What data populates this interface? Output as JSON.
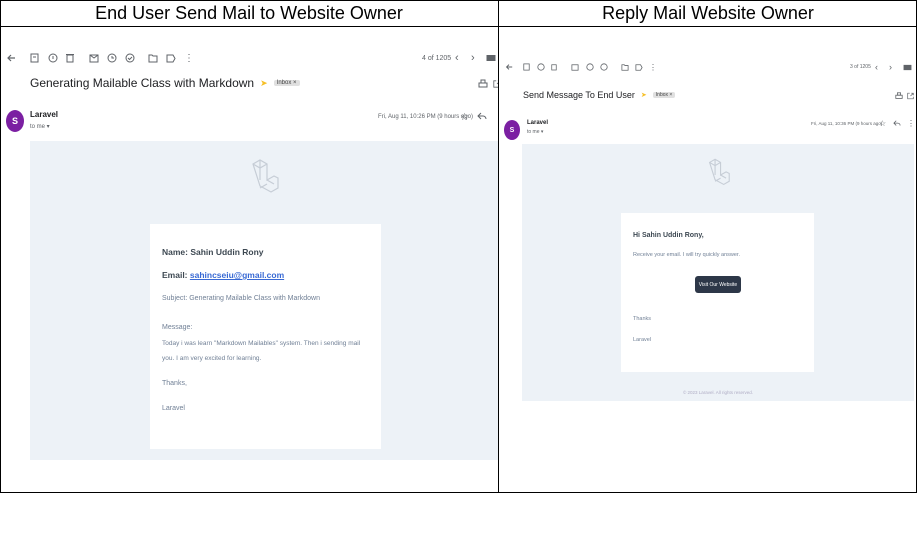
{
  "panels": {
    "left": {
      "heading": "End User Send Mail to Website Owner",
      "counter": "4 of 1205",
      "subject": "Generating Mailable Class with Markdown",
      "label": "Inbox",
      "label_close": "×",
      "sender": {
        "initial": "S",
        "name": "Laravel",
        "to": "to me ▾"
      },
      "date": "Fri, Aug 11, 10:26 PM (9 hours ago)",
      "card": {
        "name_line": "Name: Sahin Uddin Rony",
        "email_prefix": "Email: ",
        "email": "sahincseiu@gmail.com",
        "subject_line": "Subject: Generating Mailable Class with Markdown",
        "message_label": "Message:",
        "message_line1": "Today i was learn \"Markdown Mailables\" system. Then i sending mail",
        "message_line2": "you. I am very excited for learning.",
        "thanks": "Thanks,",
        "signature": "Laravel"
      }
    },
    "right": {
      "heading": "Reply Mail Website Owner",
      "counter": "3 of 1205",
      "subject": "Send Message To End User",
      "label": "Inbox",
      "label_close": "×",
      "sender": {
        "initial": "S",
        "name": "Laravel",
        "to": "to me ▾"
      },
      "date": "Fri, Aug 11, 10:36 PM (9 hours ago)",
      "card": {
        "greeting": "Hi Sahin Uddin Rony,",
        "body": "Receive your email. I will try quickly answer.",
        "button": "Visit Our Website",
        "thanks": "Thanks",
        "signature": "Laravel"
      },
      "footer": "© 2023 Laravel. All rights reserved."
    }
  },
  "icons": {
    "toolbar": [
      "back-arrow-icon",
      "archive-icon",
      "report-spam-icon",
      "delete-icon",
      "mark-unread-icon",
      "snooze-icon",
      "add-task-icon",
      "move-to-icon",
      "label-icon",
      "more-vert-icon"
    ],
    "nav": [
      "prev-icon",
      "next-icon",
      "keyboard-icon"
    ],
    "header_right": [
      "print-icon",
      "open-new-window-icon"
    ],
    "message_actions": [
      "star-icon",
      "reply-icon",
      "more-vert-icon"
    ]
  },
  "colors": {
    "avatar": "#7b1fa2",
    "mail_bg": "#edf2f7",
    "button": "#2d3748",
    "link": "#3869d4"
  }
}
